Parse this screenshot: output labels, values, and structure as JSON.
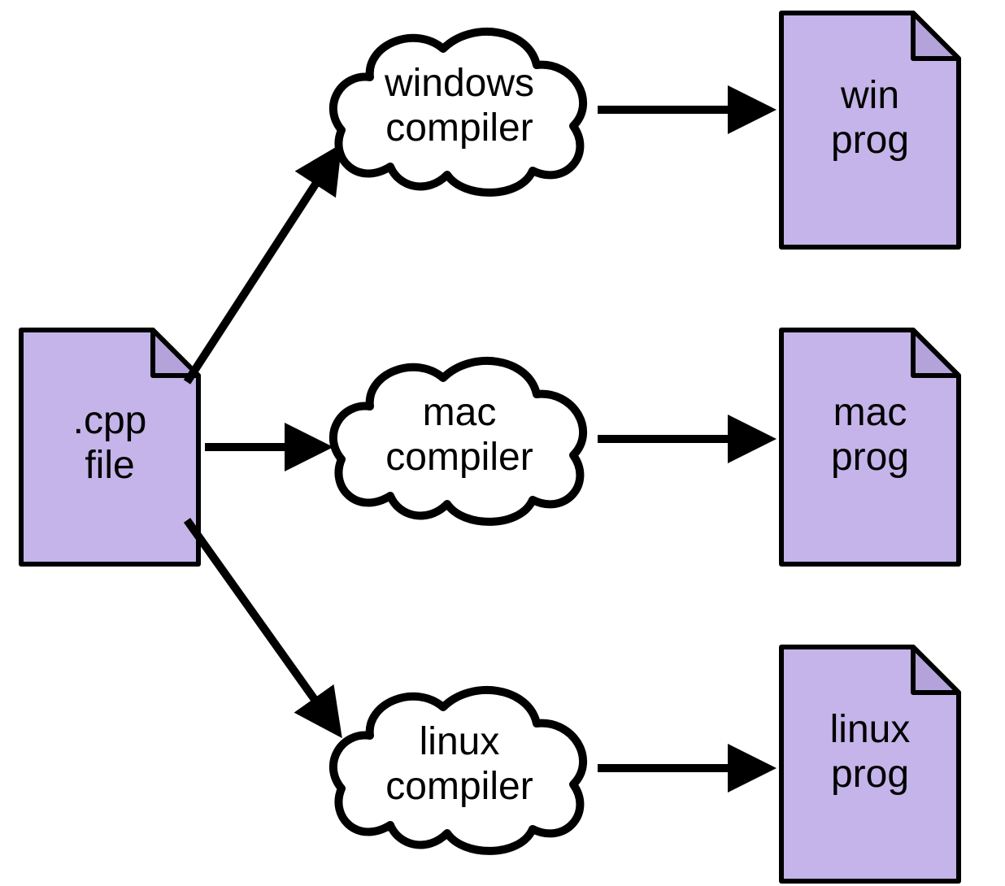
{
  "source": {
    "line1": ".cpp",
    "line2": "file"
  },
  "compilers": [
    {
      "line1": "windows",
      "line2": "compiler"
    },
    {
      "line1": "mac",
      "line2": "compiler"
    },
    {
      "line1": "linux",
      "line2": "compiler"
    }
  ],
  "outputs": [
    {
      "line1": "win",
      "line2": "prog"
    },
    {
      "line1": "mac",
      "line2": "prog"
    },
    {
      "line1": "linux",
      "line2": "prog"
    }
  ],
  "colors": {
    "file_fill": "#c4b4e9",
    "file_fold_fill": "#b4a3da",
    "stroke": "#000000",
    "cloud_fill": "#ffffff"
  }
}
